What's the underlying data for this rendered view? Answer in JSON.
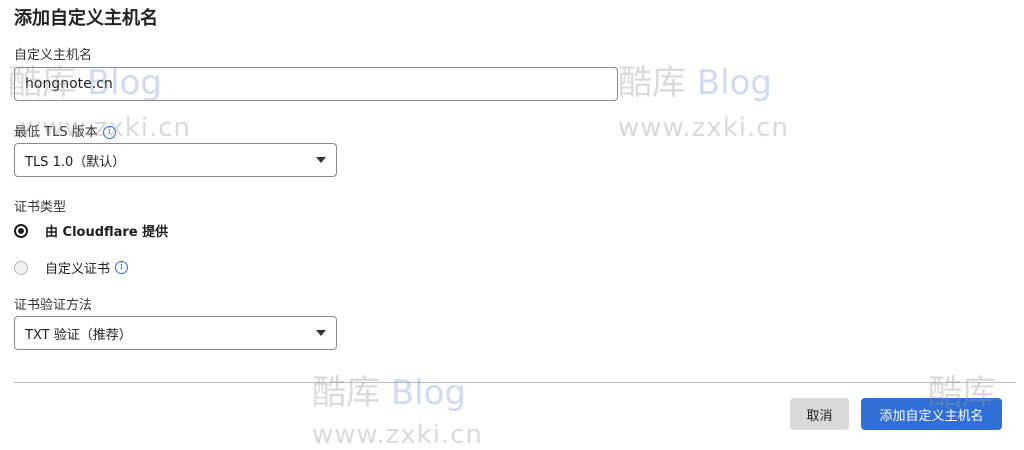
{
  "dialog": {
    "title": "添加自定义主机名",
    "hostname": {
      "label": "自定义主机名",
      "value": "hongnote.cn"
    },
    "min_tls": {
      "label": "最低 TLS 版本",
      "value": "TLS 1.0（默认）",
      "info_icon": "info-icon"
    },
    "cert_type": {
      "label": "证书类型",
      "options": [
        {
          "label": "由 Cloudflare 提供",
          "selected": true
        },
        {
          "label": "自定义证书",
          "selected": false,
          "info_icon": "info-icon"
        }
      ]
    },
    "verify": {
      "label": "证书验证方法",
      "value": "TXT 验证（推荐）"
    },
    "buttons": {
      "cancel": "取消",
      "submit": "添加自定义主机名"
    }
  },
  "watermark": {
    "brand": "酷库",
    "blog": "Blog",
    "url": "www.zxki.cn"
  },
  "colors": {
    "primary": "#2f6fd6",
    "cancel_bg": "#d9d9d9"
  }
}
